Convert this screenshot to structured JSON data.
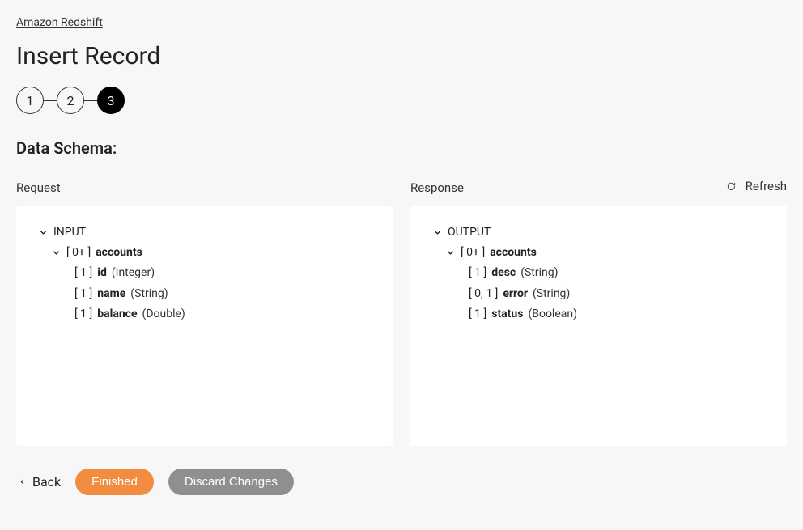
{
  "breadcrumb": "Amazon Redshift",
  "page_title": "Insert Record",
  "steps": {
    "one": "1",
    "two": "2",
    "three": "3"
  },
  "section_label": "Data Schema:",
  "refresh_label": "Refresh",
  "request": {
    "header": "Request",
    "root": "INPUT",
    "accounts_card": "[ 0+ ]",
    "accounts_label": "accounts",
    "fields": [
      {
        "card": "[ 1 ]",
        "name": "id",
        "type": "(Integer)"
      },
      {
        "card": "[ 1 ]",
        "name": "name",
        "type": "(String)"
      },
      {
        "card": "[ 1 ]",
        "name": "balance",
        "type": "(Double)"
      }
    ]
  },
  "response": {
    "header": "Response",
    "root": "OUTPUT",
    "accounts_card": "[ 0+ ]",
    "accounts_label": "accounts",
    "fields": [
      {
        "card": "[ 1 ]",
        "name": "desc",
        "type": "(String)"
      },
      {
        "card": "[ 0, 1 ]",
        "name": "error",
        "type": "(String)"
      },
      {
        "card": "[ 1 ]",
        "name": "status",
        "type": "(Boolean)"
      }
    ]
  },
  "footer": {
    "back": "Back",
    "finished": "Finished",
    "discard": "Discard Changes"
  }
}
